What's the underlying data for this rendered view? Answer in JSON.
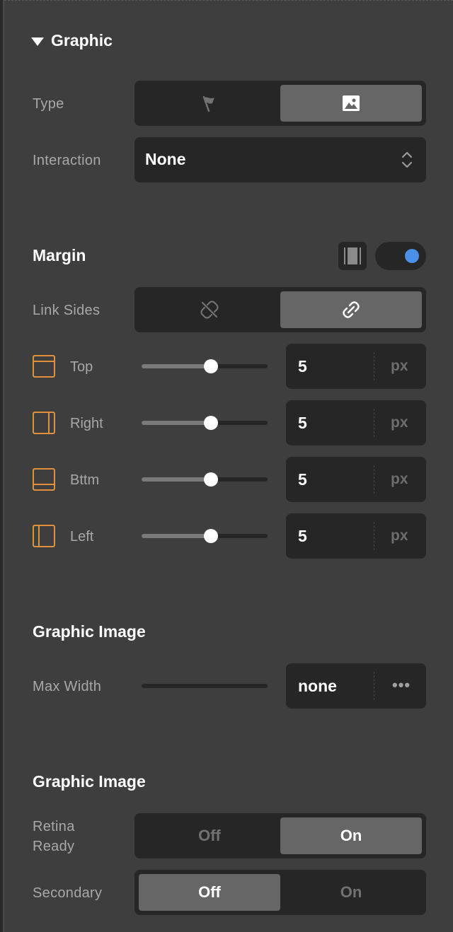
{
  "graphic": {
    "title": "Graphic",
    "type_label": "Type",
    "type_options": [
      "flag-icon",
      "image-icon"
    ],
    "type_selected": 1,
    "interaction_label": "Interaction",
    "interaction_value": "None"
  },
  "margin": {
    "title": "Margin",
    "toggle_on": true,
    "link_sides_label": "Link Sides",
    "link_sides_selected": 1,
    "sides": [
      {
        "label": "Top",
        "value": "5",
        "unit": "px",
        "slider": 0.55
      },
      {
        "label": "Right",
        "value": "5",
        "unit": "px",
        "slider": 0.55
      },
      {
        "label": "Bttm",
        "value": "5",
        "unit": "px",
        "slider": 0.55
      },
      {
        "label": "Left",
        "value": "5",
        "unit": "px",
        "slider": 0.55
      }
    ]
  },
  "graphic_image_1": {
    "title": "Graphic Image",
    "max_width_label": "Max Width",
    "max_width_value": "none",
    "more_label": "•••"
  },
  "graphic_image_2": {
    "title": "Graphic Image",
    "retina_label_line1": "Retina",
    "retina_label_line2": "Ready",
    "retina_off": "Off",
    "retina_on": "On",
    "retina_selected": "On",
    "secondary_label": "Secondary",
    "secondary_off": "Off",
    "secondary_on": "On",
    "secondary_selected": "Off"
  },
  "colors": {
    "accent_blue": "#4a8fe8",
    "side_icon_orange": "#e0913e",
    "panel_bg": "#3e3e3e",
    "control_bg": "#262626",
    "active_segment": "#666666"
  }
}
